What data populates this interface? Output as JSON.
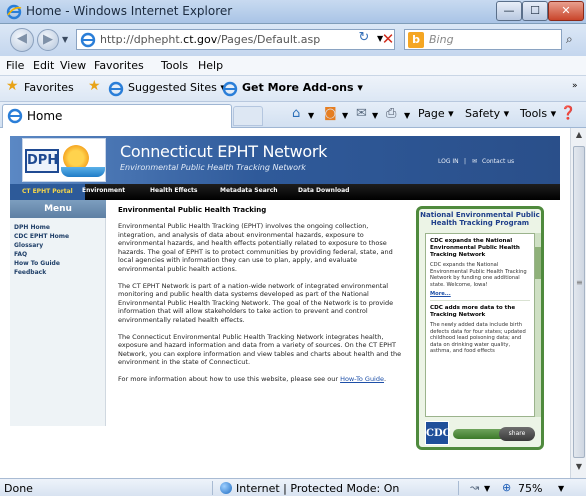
{
  "window": {
    "title": "Home - Windows Internet Explorer",
    "minimize_glyph": "—",
    "maximize_glyph": "☐",
    "close_glyph": "✕"
  },
  "address": {
    "url_prefix": "http://dphepht.",
    "url_domain": "ct.gov",
    "url_suffix": "/Pages/Default.asp",
    "search_placeholder": "Bing"
  },
  "menubar": {
    "items": [
      {
        "label": "File",
        "key": "F"
      },
      {
        "label": "Edit",
        "key": "E"
      },
      {
        "label": "View",
        "key": "V"
      },
      {
        "label": "Favorites",
        "key": "a"
      },
      {
        "label": "Tools",
        "key": "T"
      },
      {
        "label": "Help",
        "key": "H"
      }
    ]
  },
  "favorites_bar": {
    "favorites_label": "Favorites",
    "suggested_label": "Suggested Sites ▾",
    "addons_label": "Get More Add-ons ▾"
  },
  "command_bar": {
    "tab_label": "Home",
    "page_label": "Page ▾",
    "safety_label": "Safety ▾",
    "tools_label": "Tools ▾"
  },
  "site": {
    "title": "Connecticut EPHT Network",
    "subtitle": "Environmental Public Health Tracking Network",
    "login_label": "LOG IN",
    "contact_label": "Contact us",
    "logo_text": "DPH",
    "nav": [
      "CT EPHT Portal",
      "Environment",
      "Health Effects",
      "Metadata Search",
      "Data Download"
    ],
    "menu_header": "Menu",
    "menu_links": [
      "DPH Home",
      "CDC EPHT Home",
      "Glossary",
      "FAQ",
      "How To Guide",
      "Feedback"
    ],
    "heading": "Environmental Public Health Tracking",
    "paragraphs": [
      "Environmental Public Health Tracking (EPHT) involves the ongoing collection, integration, and analysis of data about environmental hazards, exposure to environmental hazards, and health effects potentially related to exposure to those hazards. The goal of EPHT is to protect communities by providing federal, state, and local agencies with information they can use to plan, apply, and evaluate environmental public health actions.",
      "The CT EPHT Network is part of a nation-wide network of integrated environmental monitoring and public health data systems developed as part of the National Environmental Public Health Tracking Network. The goal of the Network is to provide information that will allow stakeholders to take action to prevent and control environmentally related health effects.",
      "The Connecticut Environmental Public Health Tracking Network integrates health, exposure and hazard information and data from a variety of sources. On the CT EPHT Network, you can explore information and view tables and charts about health and the environment in the state of Connecticut."
    ],
    "last_paragraph_prefix": "For more information about how to use this website, please see our ",
    "last_paragraph_link": "How-To Guide",
    "last_paragraph_suffix": "."
  },
  "side_panel": {
    "title": "National Environmental Public Health Tracking Program",
    "news": [
      {
        "head": "CDC expands the National Environmental Public Health Tracking Network",
        "body": "CDC expands the National Environmental Public Health Tracking Network by funding one additional state. Welcome, Iowa!",
        "more": "More..."
      },
      {
        "head": "CDC adds more data to the Tracking Network",
        "body": "The newly added data include birth defects data for four states; updated childhood lead poisoning data; and data on drinking water quality, asthma, and food effects"
      }
    ],
    "cdc_label": "CDC",
    "share_label": "share"
  },
  "statusbar": {
    "status": "Done",
    "zone": "Internet | Protected Mode: On",
    "zoom": "75%"
  }
}
